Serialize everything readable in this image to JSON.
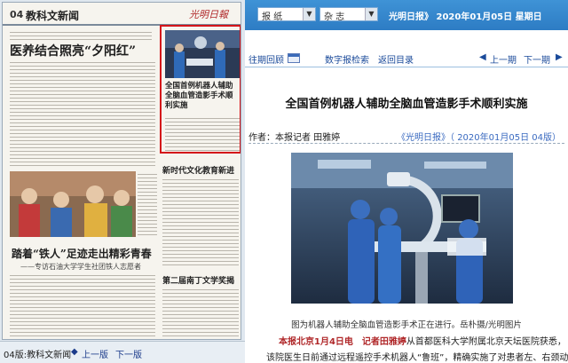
{
  "paper_page": {
    "page_number": "04",
    "section": "教科文新闻",
    "masthead": "光明日報",
    "headline_main": "医养结合照亮“夕阳红”",
    "headline_second": "踏着“铁人”足迹走出精彩青春",
    "subheadline_second": "——专访石油大学学生社团铁人志愿者",
    "column_title_1": "新时代文化教育新进行",
    "column_title_2": "第二届南丁文学奖揭晓",
    "highlight_title": "全国首例机器人辅助全脑血管造影手术顺利实施"
  },
  "left_footer": {
    "page_label": "04版:教科文新闻",
    "prev_label": "上一版",
    "next_label": "下一版"
  },
  "toolbar": {
    "select_1": "报 纸",
    "select_2": "杂 志",
    "date_text": "光明日报》 2020年01月05日 星期日"
  },
  "nav": {
    "archive": "往期回顾",
    "search": "数字报检索",
    "back": "返回目录",
    "prev": "上一期",
    "next": "下一期"
  },
  "article": {
    "title": "全国首例机器人辅助全脑血管造影手术顺利实施",
    "byline": "作者：本报记者 田雅婷",
    "source": "《光明日报》（ 2020年01月05日  04版）",
    "caption": "图为机器人辅助全脑血管造影手术正在进行。岳朴摄/光明图片",
    "lede": "本报北京1月4日电　记者田雅婷",
    "body_line_1": "从首都医科大学附属北京天坛医院获悉，",
    "body_line_2": "该院医生日前通过远程遥控手术机器人“鲁班”，精确实施了对患者左、右颈动脉、"
  }
}
